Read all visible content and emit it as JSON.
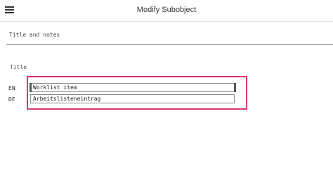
{
  "header": {
    "title": "Modify Subobject",
    "menu_icon": "hamburger-menu-icon"
  },
  "section": {
    "title": "Title and notes"
  },
  "field": {
    "label": "Title",
    "languages": [
      {
        "code": "EN",
        "value": "Worklist item"
      },
      {
        "code": "DE",
        "value": "Arbeitslisteneintrag"
      }
    ]
  },
  "colors": {
    "highlight": "#d9376a",
    "section_rule": "#9a9a9a"
  }
}
